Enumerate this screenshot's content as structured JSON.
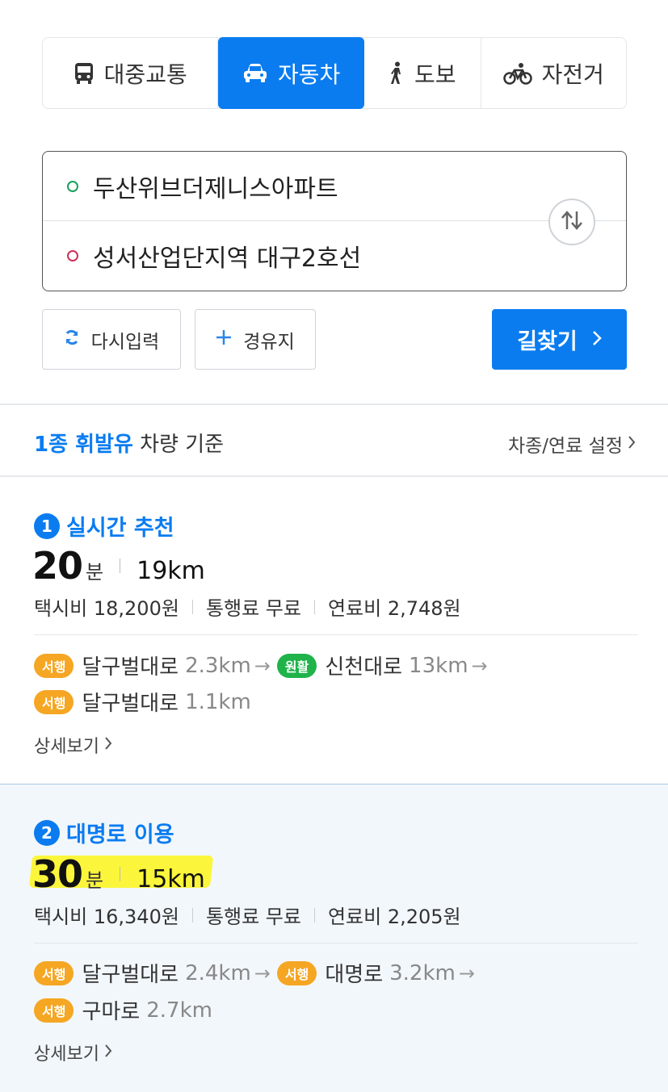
{
  "tabs": [
    {
      "label": "대중교통",
      "icon": "bus-icon",
      "active": false
    },
    {
      "label": "자동차",
      "icon": "car-icon",
      "active": true
    },
    {
      "label": "도보",
      "icon": "walk-icon",
      "active": false
    },
    {
      "label": "자전거",
      "icon": "bicycle-icon",
      "active": false
    }
  ],
  "search": {
    "origin": "두산위브더제니스아파트",
    "destination": "성서산업단지역 대구2호선"
  },
  "buttons": {
    "reset": "다시입력",
    "waypoint": "경유지",
    "find_route": "길찾기"
  },
  "vehicle": {
    "type_highlight": "1종 휘발유",
    "type_rest": "차량 기준",
    "settings_link": "차종/연료 설정"
  },
  "routes": [
    {
      "rank": "1",
      "title": "실시간 추천",
      "time_value": "20",
      "time_unit": "분",
      "distance": "19km",
      "taxi": "택시비 18,200원",
      "toll": "통행료 무료",
      "fuel": "연료비 2,748원",
      "segments_line1": [
        {
          "badge": "서행",
          "badge_color": "#f5a623",
          "road": "달구벌대로",
          "km": "2.3km"
        },
        {
          "badge": "원활",
          "badge_color": "#1fb34a",
          "road": "신천대로",
          "km": "13km"
        }
      ],
      "segments_line2": [
        {
          "badge": "서행",
          "badge_color": "#f5a623",
          "road": "달구벌대로",
          "km": "1.1km"
        }
      ],
      "detail": "상세보기"
    },
    {
      "rank": "2",
      "title": "대명로 이용",
      "time_value": "30",
      "time_unit": "분",
      "distance": "15km",
      "taxi": "택시비 16,340원",
      "toll": "통행료 무료",
      "fuel": "연료비 2,205원",
      "segments_line1": [
        {
          "badge": "서행",
          "badge_color": "#f5a623",
          "road": "달구벌대로",
          "km": "2.4km"
        },
        {
          "badge": "서행",
          "badge_color": "#f5a623",
          "road": "대명로",
          "km": "3.2km"
        }
      ],
      "segments_line2": [
        {
          "badge": "서행",
          "badge_color": "#f5a623",
          "road": "구마로",
          "km": "2.7km"
        }
      ],
      "detail": "상세보기"
    }
  ],
  "colors": {
    "accent": "#0a7cf0",
    "slow_badge": "#f5a623",
    "smooth_badge": "#1fb34a",
    "highlight": "#fbf63b"
  }
}
